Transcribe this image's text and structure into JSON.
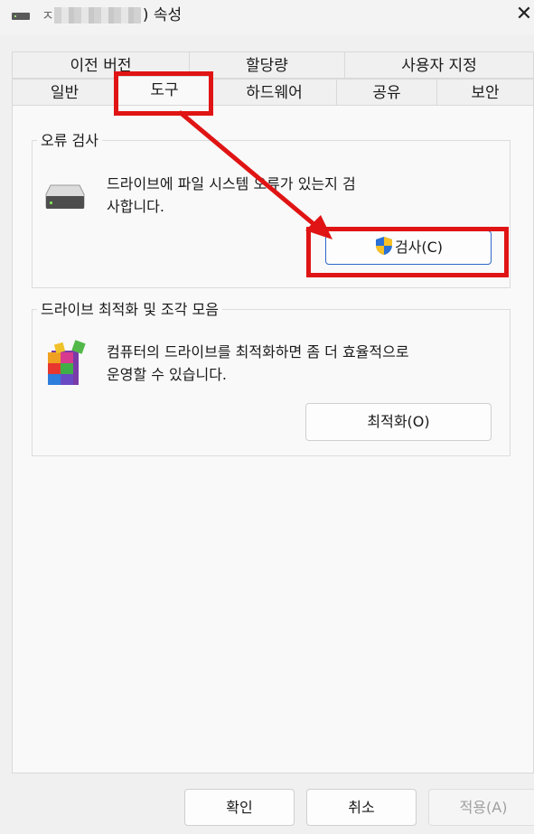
{
  "window": {
    "title_suffix": ") 속성",
    "close_glyph": "✕"
  },
  "tabs": {
    "row1": [
      {
        "label": "이전 버전"
      },
      {
        "label": "할당량"
      },
      {
        "label": "사용자 지정"
      }
    ],
    "row2": [
      {
        "label": "일반"
      },
      {
        "label": "도구"
      },
      {
        "label": "하드웨어"
      },
      {
        "label": "공유"
      },
      {
        "label": "보안"
      }
    ],
    "active": "도구"
  },
  "error_check": {
    "group_title": "오류 검사",
    "desc_line1": "드라이브에 파일 시스템 오류가 있는지 검",
    "desc_line2": "사합니다.",
    "button_label": "검사(C)",
    "icon": "drive-icon"
  },
  "optimize": {
    "group_title": "드라이브 최적화 및 조각 모음",
    "desc_line1": "컴퓨터의 드라이브를 최적화하면 좀 더 효율적으로",
    "desc_line2": "운영할 수 있습니다.",
    "button_label": "최적화(O)",
    "icon": "defrag-icon"
  },
  "footer": {
    "ok_label": "확인",
    "cancel_label": "취소",
    "apply_label": "적용(A)"
  },
  "colors": {
    "highlight": "#e01414",
    "accent": "#2f66c9"
  }
}
